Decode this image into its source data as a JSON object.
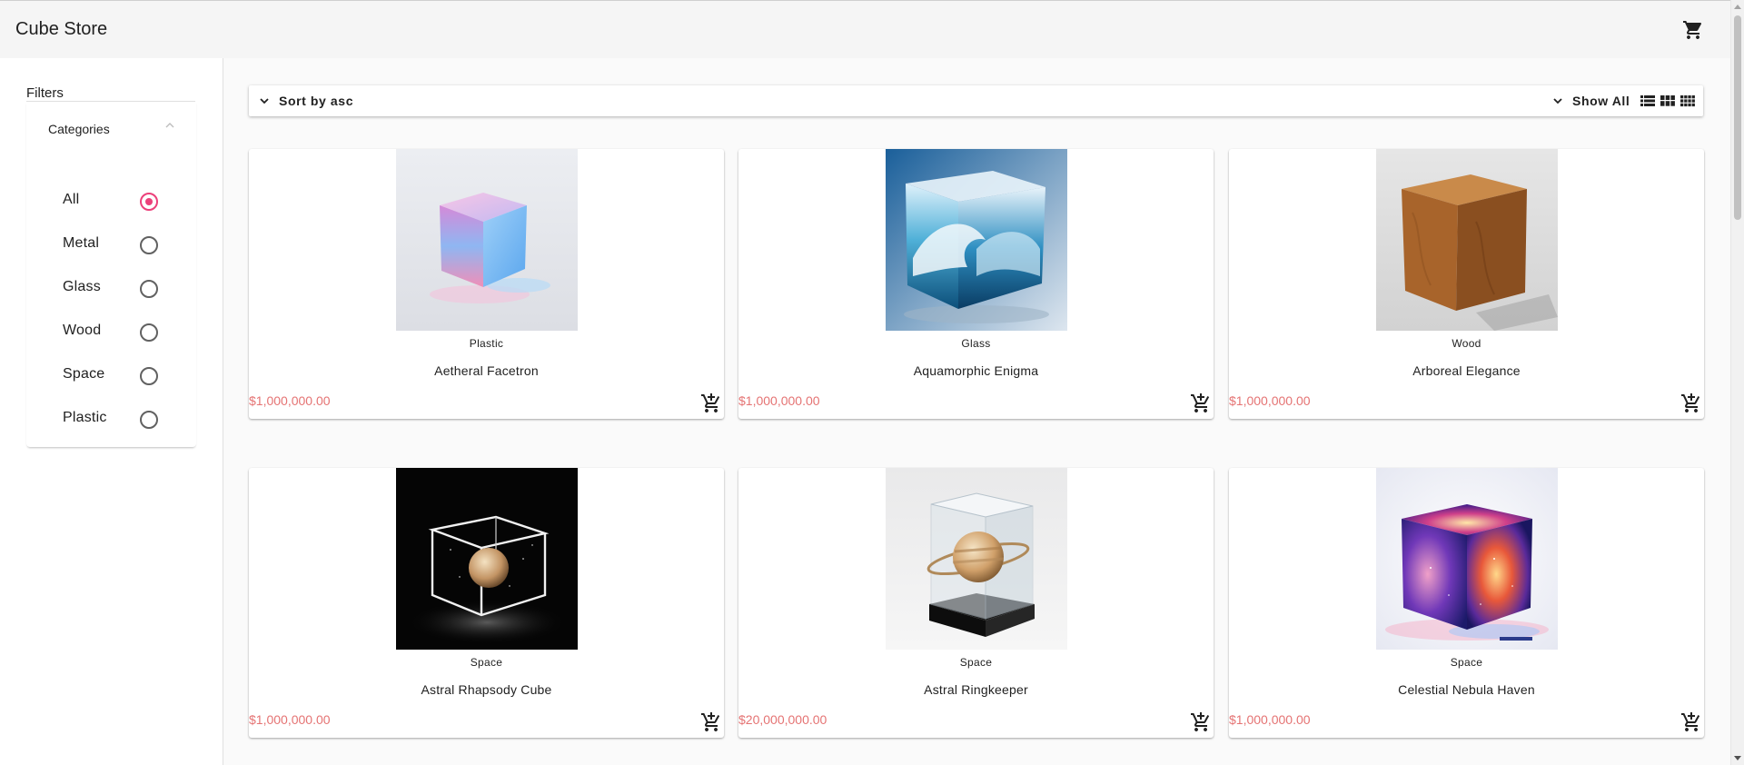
{
  "app": {
    "title": "Cube Store",
    "cart_icon": "shopping-cart-icon"
  },
  "sidebar": {
    "filters_title": "Filters",
    "categories_title": "Categories",
    "selected": "All",
    "items": [
      {
        "label": "All",
        "selected": true
      },
      {
        "label": "Metal",
        "selected": false
      },
      {
        "label": "Glass",
        "selected": false
      },
      {
        "label": "Wood",
        "selected": false
      },
      {
        "label": "Space",
        "selected": false
      },
      {
        "label": "Plastic",
        "selected": false
      }
    ]
  },
  "toolbar": {
    "sort_label": "Sort by asc",
    "show_label": "Show All",
    "view_icons": [
      "view-list-icon",
      "view-module-icon",
      "view-comfy-icon"
    ]
  },
  "products": [
    {
      "category": "Plastic",
      "name": "Aetheral Facetron",
      "price": "$1,000,000.00"
    },
    {
      "category": "Glass",
      "name": "Aquamorphic Enigma",
      "price": "$1,000,000.00"
    },
    {
      "category": "Wood",
      "name": "Arboreal Elegance",
      "price": "$1,000,000.00"
    },
    {
      "category": "Space",
      "name": "Astral Rhapsody Cube",
      "price": "$1,000,000.00"
    },
    {
      "category": "Space",
      "name": "Astral Ringkeeper",
      "price": "$20,000,000.00"
    },
    {
      "category": "Space",
      "name": "Celestial Nebula Haven",
      "price": "$1,000,000.00"
    }
  ],
  "colors": {
    "accent": "#ec407a",
    "price": "#e57373",
    "topbar": "#f5f5f5"
  }
}
